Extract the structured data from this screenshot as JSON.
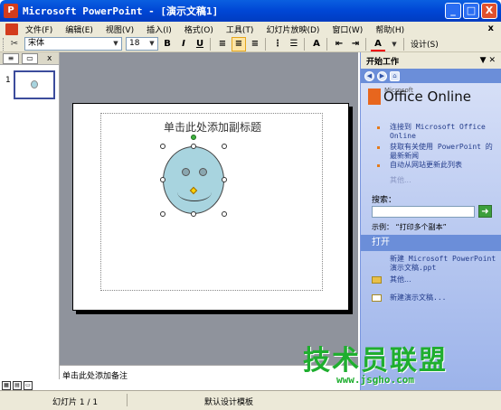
{
  "window": {
    "title": "Microsoft PowerPoint - [演示文稿1]",
    "app_icon": "powerpoint-icon",
    "buttons": [
      "_",
      "□",
      "X"
    ]
  },
  "menu": {
    "items": [
      "文件(F)",
      "编辑(E)",
      "视图(V)",
      "插入(I)",
      "格式(O)",
      "工具(T)",
      "幻灯片放映(D)",
      "窗口(W)",
      "帮助(H)"
    ],
    "close": "x"
  },
  "toolbar": {
    "font_name": "宋体",
    "font_size": "18",
    "bold": "B",
    "italic": "I",
    "underline": "U",
    "font_color_label": "A",
    "design_label": "设计(S)"
  },
  "slide_panel": {
    "slide_number": "1",
    "close": "x"
  },
  "slide": {
    "subtitle_placeholder": "单击此处添加副标题"
  },
  "notes": {
    "placeholder": "单击此处添加备注"
  },
  "task_pane": {
    "title": "开始工作",
    "logo_small": "Microsoft",
    "logo_text": "Office Online",
    "links": [
      "连接到 Microsoft Office Online",
      "获取有关使用 PowerPoint 的最新新闻",
      "自动从网站更新此列表"
    ],
    "more1": "其他...",
    "search_label": "搜索：",
    "example": "示例：  “打印多个副本”",
    "open_section": "打开",
    "new_link": "新建 Microsoft PowerPoint 演示文稿.ppt",
    "more2": "其他...",
    "new_presentation": "新建演示文稿..."
  },
  "status": {
    "slide_info": "幻灯片 1 / 1",
    "design": "默认设计模板"
  },
  "watermark": {
    "brand": "技术员联盟",
    "url": "www.jsgho.com"
  },
  "colors": {
    "title_bar": "#0046d5",
    "task_pane_bg": "#d6dff7",
    "slide_face": "#a8d4df",
    "watermark": "#1fae2f"
  }
}
